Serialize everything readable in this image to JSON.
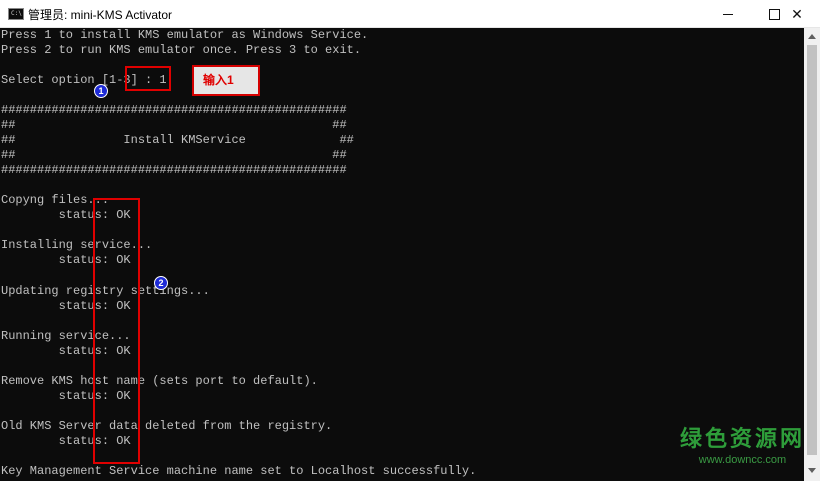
{
  "window": {
    "icon_label": "C:\\",
    "title": "管理员: mini-KMS Activator",
    "minimize_icon": "minimize-icon",
    "maximize_icon": "maximize-icon",
    "close_glyph": "✕"
  },
  "console": {
    "lines": [
      "Press 1 to install KMS emulator as Windows Service.",
      "Press 2 to run KMS emulator once. Press 3 to exit.",
      "Select option [1-3] : 1",
      "################################################",
      "##                                            ##",
      "##               Install KMService             ##",
      "##                                            ##",
      "################################################",
      "Copyng files...",
      "        status: OK",
      "Installing service...",
      "        status: OK",
      "Updating registry settings...",
      "        status: OK",
      "Running service...",
      "        status: OK",
      "Remove KMS host name (sets port to default).",
      "        status: OK",
      "Old KMS Server data deleted from the registry.",
      "        status: OK",
      "Key Management Service machine name set to Localhost successfully."
    ]
  },
  "annotations": {
    "note_label": "输入1",
    "badge_1": "1",
    "badge_2": "2",
    "box_color": "#e00000",
    "badge_color": "#1e2bd6"
  },
  "watermark": {
    "title": "绿色资源网",
    "url": "www.downcc.com"
  }
}
